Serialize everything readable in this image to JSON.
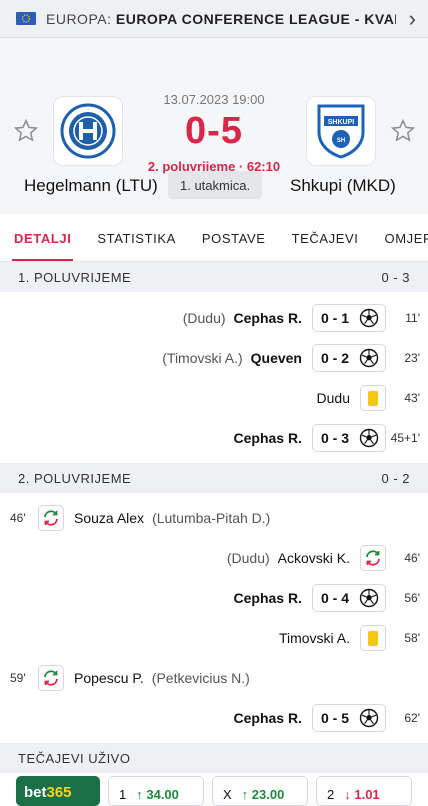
{
  "topbar": {
    "region": "EUROPA:",
    "competition": "EUROPA CONFERENCE LEAGUE - KVALIFIK..."
  },
  "match": {
    "date": "13.07.2023 19:00",
    "score": "0-5",
    "status": "2. poluvrijeme · 62:10",
    "round": "1. utakmica.",
    "home": {
      "name": "Hegelmann (LTU)"
    },
    "away": {
      "name": "Shkupi (MKD)"
    }
  },
  "tabs": [
    "DETALJI",
    "STATISTIKA",
    "POSTAVE",
    "TEČAJEVI",
    "OMJER"
  ],
  "halves": [
    {
      "label": "1. POLUVRIJEME",
      "score": "0 - 3"
    },
    {
      "label": "2. POLUVRIJEME",
      "score": "0 - 2"
    }
  ],
  "events": [
    {
      "assist": "(Dudu)",
      "player": "Cephas R.",
      "score": "0 - 1",
      "minute": "11'"
    },
    {
      "assist": "(Timovski A.)",
      "player": "Queven",
      "score": "0 - 2",
      "minute": "23'"
    },
    {
      "player": "Dudu",
      "minute": "43'"
    },
    {
      "player": "Cephas R.",
      "score": "0 - 3",
      "minute": "45+1'"
    },
    {
      "minute": "46'",
      "player": "Souza Alex",
      "assist": "(Lutumba-Pitah D.)"
    },
    {
      "assist": "(Dudu)",
      "player": "Ackovski K.",
      "minute": "46'"
    },
    {
      "player": "Cephas R.",
      "score": "0 - 4",
      "minute": "56'"
    },
    {
      "player": "Timovski A.",
      "minute": "58'"
    },
    {
      "minute": "59'",
      "player": "Popescu P.",
      "assist": "(Petkevicius N.)"
    },
    {
      "player": "Cephas R.",
      "score": "0 - 5",
      "minute": "62'"
    }
  ],
  "odds": {
    "title": "TEČAJEVI UŽIVO",
    "bookmaker": {
      "part1": "bet",
      "part2": "365"
    },
    "items": [
      {
        "label": "1",
        "value": "34.00"
      },
      {
        "label": "X",
        "value": "23.00"
      },
      {
        "label": "2",
        "value": "1.01"
      }
    ]
  },
  "colors": {
    "accent": "#d9264a",
    "yellow_card": "#f6c70f",
    "bookmaker": "#1b6f47"
  }
}
